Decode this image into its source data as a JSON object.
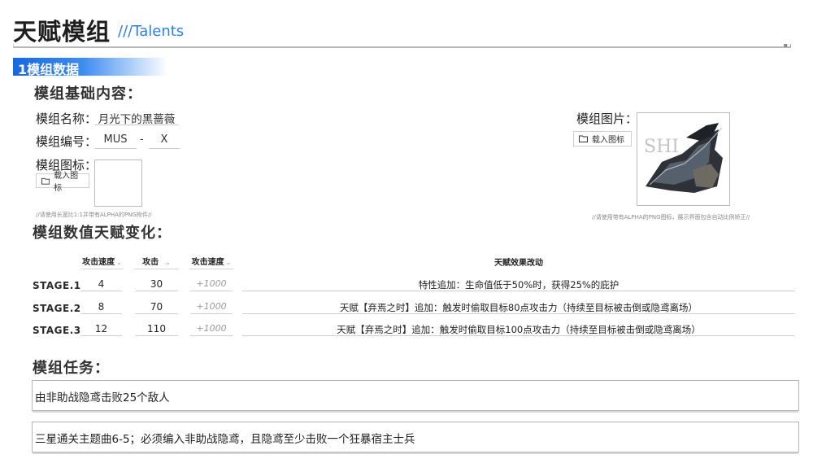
{
  "header": {
    "title": "天赋模组",
    "subtitle": "///Talents"
  },
  "section": {
    "title": "1模组数据"
  },
  "basic": {
    "heading": "模组基础内容：",
    "name_label": "模组名称：",
    "name_value": "月光下的黑蔷薇",
    "code_label": "模组编号：",
    "code_prefix": "MUS",
    "code_sep": "-",
    "code_suffix": "X",
    "icon_label": "模组图标：",
    "icon_button": "载入图标",
    "icon_hint": "//请使用长宽比1:1并带有ALPHA的PNG附件//",
    "image_label": "模组图片：",
    "image_button": "载入图标",
    "image_hint": "//请使用带有ALPHA的PNG图标，展示界面包含自动比例矫正//",
    "image_text": "SHI"
  },
  "stats": {
    "heading": "模组数值天赋变化：",
    "columns": [
      "攻击速度",
      "攻击",
      "攻击速度",
      "天赋效果改动"
    ],
    "rows": [
      {
        "stage": "STAGE.1",
        "v1": "4",
        "v2": "30",
        "v3": "+1000",
        "effect": "特性追加：生命值低于50%时，获得25%的庇护"
      },
      {
        "stage": "STAGE.2",
        "v1": "8",
        "v2": "70",
        "v3": "+1000",
        "effect": "天赋【弃焉之时】追加：触发时偷取目标80点攻击力（持续至目标被击倒或隐鸢离场）"
      },
      {
        "stage": "STAGE.3",
        "v1": "12",
        "v2": "110",
        "v3": "+1000",
        "effect": "天赋【弃焉之时】追加：触发时偷取目标100点攻击力（持续至目标被击倒或隐鸢离场）"
      }
    ]
  },
  "tasks": {
    "heading": "模组任务：",
    "items": [
      "由非助战隐鸢击败25个敌人",
      "三星通关主题曲6-5；必须编入非助战隐鸢，且隐鸢至少击败一个狂暴宿主士兵"
    ]
  }
}
